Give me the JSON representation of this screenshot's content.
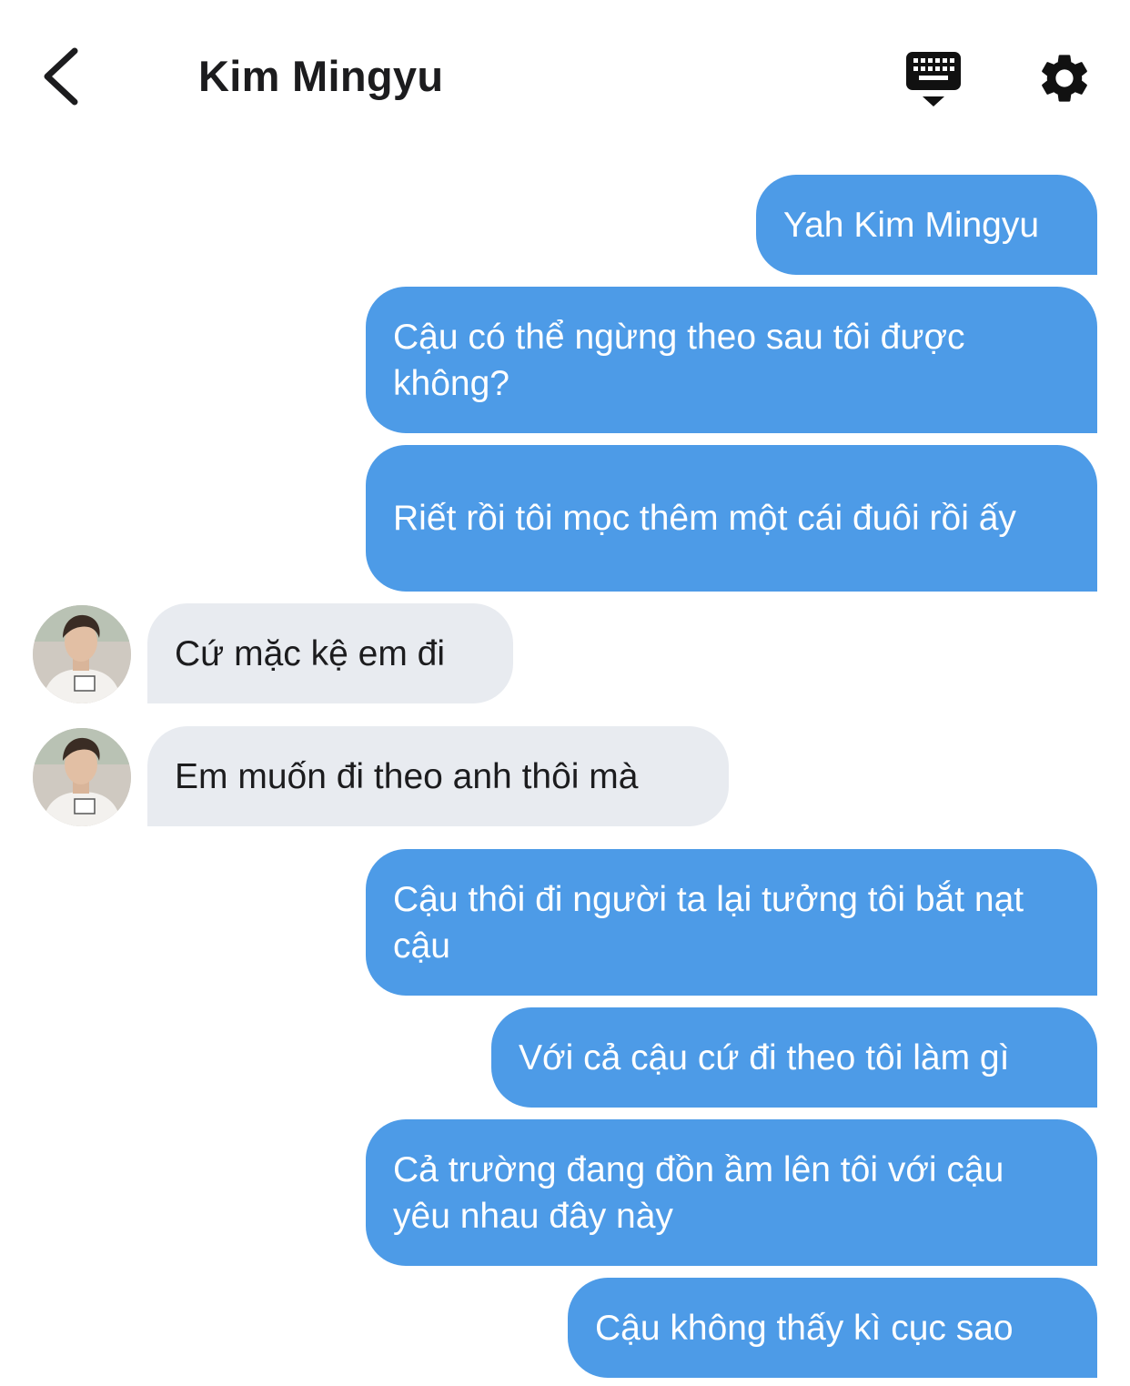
{
  "header": {
    "back_icon": "chevron-left-icon",
    "title": "Kim Mingyu",
    "keyboard_icon": "keyboard-icon",
    "settings_icon": "gear-icon"
  },
  "colors": {
    "outgoing_bubble": "#4d9be7",
    "incoming_bubble": "#e8ebf0",
    "text_dark": "#1c1c1e",
    "text_light": "#ffffff"
  },
  "messages": [
    {
      "from": "me",
      "text": "Yah Kim Mingyu"
    },
    {
      "from": "me",
      "text": "Cậu có thể ngừng theo sau tôi được không?"
    },
    {
      "from": "me",
      "text": "Riết rồi tôi mọc thêm một cái đuôi rồi ấy"
    },
    {
      "from": "them",
      "text": "Cứ mặc kệ em đi"
    },
    {
      "from": "them",
      "text": "Em muốn đi theo anh thôi mà"
    },
    {
      "from": "me",
      "text": "Cậu thôi đi người ta lại tưởng tôi bắt nạt cậu"
    },
    {
      "from": "me",
      "text": "Với cả cậu cứ đi theo tôi làm gì"
    },
    {
      "from": "me",
      "text": "Cả trường đang đồn ầm lên tôi với cậu yêu nhau đây này"
    },
    {
      "from": "me",
      "text": "Cậu không thấy kì cục sao"
    }
  ]
}
